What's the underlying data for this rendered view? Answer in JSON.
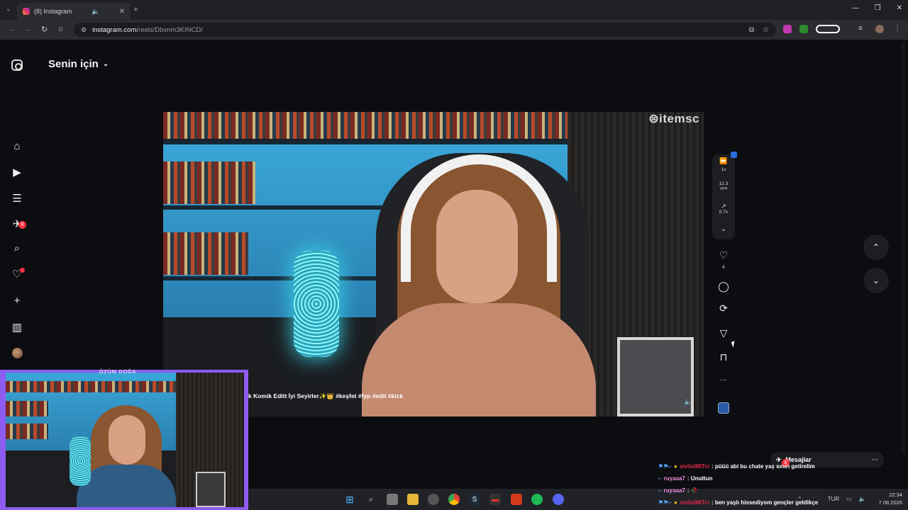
{
  "browser": {
    "tab_title": "(8) Instagram",
    "new_tab_label": "+",
    "url_host": "instagram.com",
    "url_path": "/reels/Dbvnm3KINCD/",
    "window_controls": [
      "—",
      "❐",
      "✕"
    ]
  },
  "instagram": {
    "feed_title": "Senin için",
    "sidebar": {
      "items": [
        {
          "name": "home-icon",
          "glyph": "⌂"
        },
        {
          "name": "reels-icon",
          "glyph": "▶"
        },
        {
          "name": "feed-list-icon",
          "glyph": "☰"
        },
        {
          "name": "direct-icon",
          "glyph": "✈",
          "badge": "8"
        },
        {
          "name": "search-icon",
          "glyph": "⌕"
        },
        {
          "name": "heart-icon",
          "glyph": "♡"
        },
        {
          "name": "create-icon",
          "glyph": "+"
        },
        {
          "name": "dashboard-icon",
          "glyph": "▥"
        }
      ]
    },
    "reel": {
      "watermark": "⊜itemsc",
      "caption": "k Komik Editt İyi Seyirler✨👑 #keşfet #fyp #edit #kick"
    },
    "controls": {
      "speed": "1x",
      "vph_value": "12.3",
      "vph_label": "VPH",
      "ratio": "0.7x",
      "like_count": "4"
    },
    "actions": [
      {
        "name": "like-icon",
        "glyph": "♡"
      },
      {
        "name": "comment-icon",
        "glyph": "◯"
      },
      {
        "name": "repost-icon",
        "glyph": "⟳"
      },
      {
        "name": "share-icon",
        "glyph": "▽"
      },
      {
        "name": "save-icon",
        "glyph": "⊓"
      },
      {
        "name": "more-icon",
        "glyph": "···"
      }
    ],
    "messages_label": "Mesajlar",
    "messages_badge": "8"
  },
  "webcam": {
    "streamer_name": "ÖZÜM DOĞA"
  },
  "chat": [
    {
      "user": "sivilsiMITci",
      "text": ": püüü abi bu chate yaş sınırı getirelim",
      "color": "u1"
    },
    {
      "user": "ruyaaa7",
      "text": ": Unuttun",
      "color": "u2"
    },
    {
      "user": "ruyaaa7",
      "text": ": 🥀",
      "color": "u2"
    },
    {
      "user": "sivilsiMITci",
      "text": ": ben yaşlı hissediyom gençler geldikçe",
      "color": "u1"
    }
  ],
  "taskbar": {
    "language": "TUR",
    "time": "22:34",
    "date": "7.08.2026"
  }
}
